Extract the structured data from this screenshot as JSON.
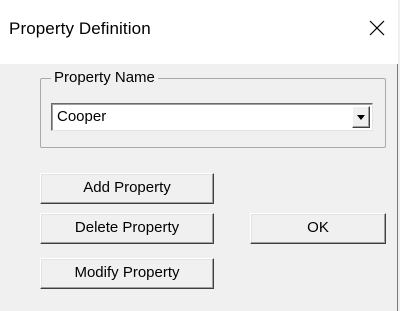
{
  "window": {
    "title": "Property Definition",
    "close_icon": "close-icon"
  },
  "property_group": {
    "legend": "Property Name",
    "selected_value": "Cooper",
    "dropdown_icon": "chevron-down-icon"
  },
  "buttons": {
    "add": "Add Property",
    "delete": "Delete Property",
    "modify": "Modify Property",
    "ok": "OK"
  }
}
